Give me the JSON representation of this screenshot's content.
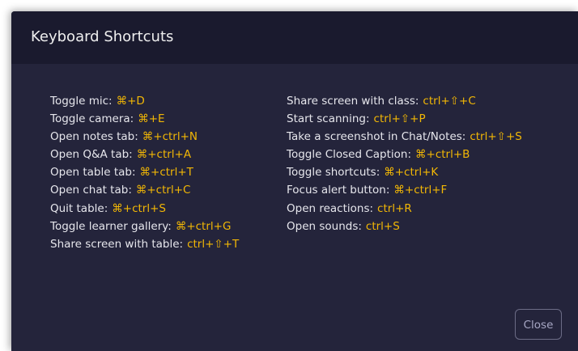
{
  "dialog": {
    "title": "Keyboard Shortcuts",
    "close_label": "Close"
  },
  "shortcuts_left": [
    {
      "label": "Toggle mic:",
      "keys": "⌘+D"
    },
    {
      "label": "Toggle camera:",
      "keys": "⌘+E"
    },
    {
      "label": "Open notes tab:",
      "keys": "⌘+ctrl+N"
    },
    {
      "label": "Open Q&A tab:",
      "keys": "⌘+ctrl+A"
    },
    {
      "label": "Open table tab:",
      "keys": "⌘+ctrl+T"
    },
    {
      "label": "Open chat tab:",
      "keys": "⌘+ctrl+C"
    },
    {
      "label": "Quit table:",
      "keys": "⌘+ctrl+S"
    },
    {
      "label": "Toggle learner gallery:",
      "keys": "⌘+ctrl+G"
    },
    {
      "label": "Share screen with table:",
      "keys": "ctrl+⇧+T"
    }
  ],
  "shortcuts_right": [
    {
      "label": "Share screen with class:",
      "keys": "ctrl+⇧+C"
    },
    {
      "label": "Start scanning:",
      "keys": "ctrl+⇧+P"
    },
    {
      "label": "Take a screenshot in Chat/Notes:",
      "keys": "ctrl+⇧+S"
    },
    {
      "label": "Toggle Closed Caption:",
      "keys": "⌘+ctrl+B"
    },
    {
      "label": "Toggle shortcuts:",
      "keys": "⌘+ctrl+K"
    },
    {
      "label": "Focus alert button:",
      "keys": "⌘+ctrl+F"
    },
    {
      "label": "Open reactions:",
      "keys": "ctrl+R"
    },
    {
      "label": "Open sounds:",
      "keys": "ctrl+S"
    }
  ],
  "colors": {
    "dialog_body": "#24243b",
    "dialog_header": "#1a1a2e",
    "shortcut_key": "#f2b705",
    "label_text": "#e6e6ec"
  }
}
